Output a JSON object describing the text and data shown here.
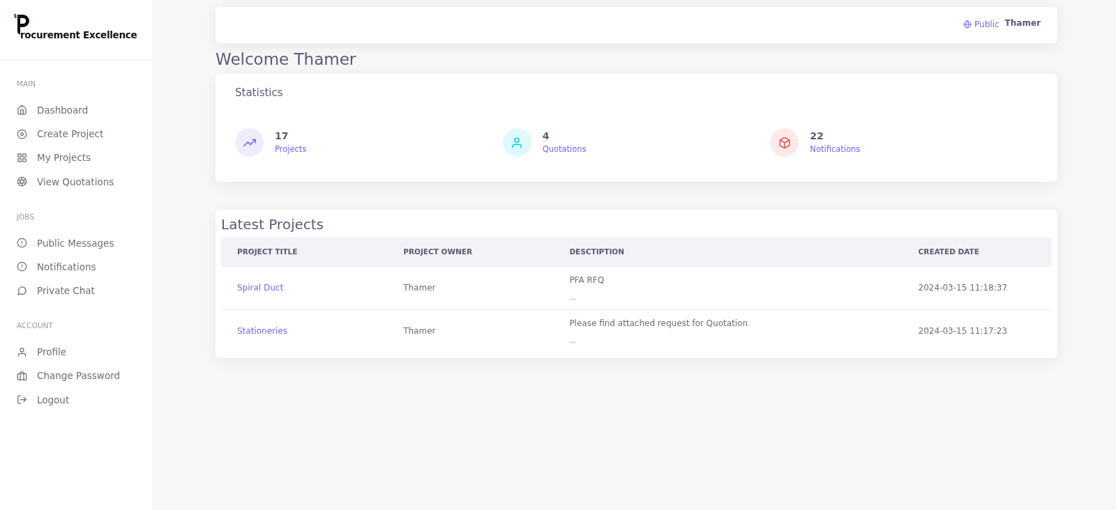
{
  "logo": {
    "text": "rocurement Excellence"
  },
  "sidebar": {
    "sections": [
      {
        "heading": "MAIN",
        "items": [
          {
            "label": "Dashboard",
            "kind": "home"
          },
          {
            "label": "Create Project",
            "kind": "target"
          },
          {
            "label": "My Projects",
            "kind": "grid"
          },
          {
            "label": "View Quotations",
            "kind": "aperture"
          }
        ]
      },
      {
        "heading": "JOBS",
        "items": [
          {
            "label": "Public Messages",
            "kind": "alert"
          },
          {
            "label": "Notifications",
            "kind": "alert"
          },
          {
            "label": "Private Chat",
            "kind": "chat"
          }
        ]
      },
      {
        "heading": "ACCOUNT",
        "items": [
          {
            "label": "Profile",
            "kind": "user"
          },
          {
            "label": "Change Password",
            "kind": "briefcase"
          },
          {
            "label": "Logout",
            "kind": "logout"
          }
        ]
      }
    ]
  },
  "topbar": {
    "visibility": "Public",
    "user": "Thamer"
  },
  "welcome": "Welcome Thamer",
  "statistics": {
    "title": "Statistics",
    "items": [
      {
        "value": "17",
        "label": "Projects",
        "kind": "trend",
        "color": "#7367f0"
      },
      {
        "value": "4",
        "label": "Quotations",
        "kind": "user",
        "color": "#00cfe8"
      },
      {
        "value": "22",
        "label": "Notifications",
        "kind": "box",
        "color": "#ea5455"
      }
    ]
  },
  "latest_projects": {
    "title": "Latest Projects",
    "columns": [
      "PROJECT TITLE",
      "PROJECT OWNER",
      "DESCTIPTION",
      "CREATED DATE"
    ],
    "rows": [
      {
        "title": "Spiral Duct",
        "owner": "Thamer",
        "description": "PFA RFQ",
        "more": "...",
        "created": "2024-03-15 11:18:37"
      },
      {
        "title": "Stationeries",
        "owner": "Thamer",
        "description": "Please find attached request for Quotation",
        "more": "...",
        "created": "2024-03-15 11:17:23"
      }
    ]
  }
}
